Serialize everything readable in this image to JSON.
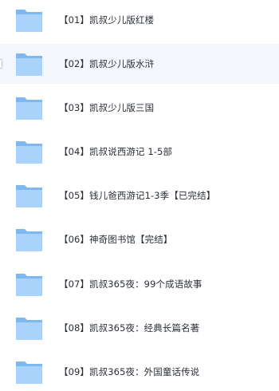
{
  "files": [
    {
      "name": "【01】凯叔少儿版红楼",
      "icon": "folder-icon"
    },
    {
      "name": "【02】凯叔少儿版水浒",
      "icon": "folder-icon",
      "hovered": true
    },
    {
      "name": "【03】凯叔少儿版三国",
      "icon": "folder-icon"
    },
    {
      "name": "【04】凯叔说西游记 1-5部",
      "icon": "folder-icon"
    },
    {
      "name": "【05】钱儿爸西游记1-3季【已完结】",
      "icon": "folder-icon"
    },
    {
      "name": "【06】神奇图书馆【完结】",
      "icon": "folder-icon"
    },
    {
      "name": "【07】凯叔365夜：99个成语故事",
      "icon": "folder-icon"
    },
    {
      "name": "【08】凯叔365夜：经典长篇名著",
      "icon": "folder-icon"
    },
    {
      "name": "【09】凯叔365夜：外国童话传说",
      "icon": "folder-icon"
    }
  ],
  "colors": {
    "folder_back": "#7fb8ee",
    "folder_front": "#a9d3fa",
    "hover_bg": "#f3f6fb"
  }
}
